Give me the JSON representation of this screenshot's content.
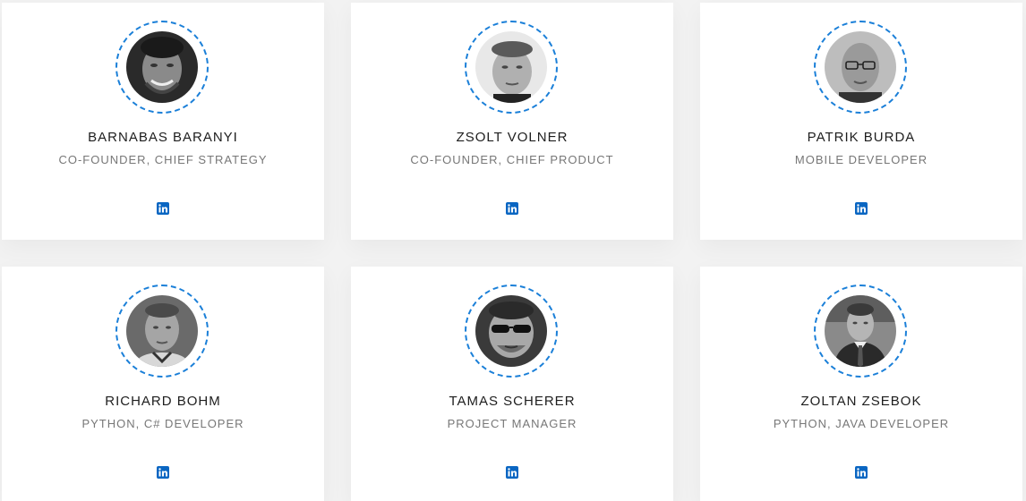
{
  "team": [
    {
      "name": "BARNABAS BARANYI",
      "role": "CO-FOUNDER, CHIEF STRATEGY",
      "social_icon": "linkedin-icon"
    },
    {
      "name": "ZSOLT VOLNER",
      "role": "CO-FOUNDER, CHIEF PRODUCT",
      "social_icon": "linkedin-icon"
    },
    {
      "name": "PATRIK BURDA",
      "role": "MOBILE DEVELOPER",
      "social_icon": "linkedin-icon"
    },
    {
      "name": "RICHARD BOHM",
      "role": "PYTHON, C# DEVELOPER",
      "social_icon": "linkedin-icon"
    },
    {
      "name": "TAMAS SCHERER",
      "role": "PROJECT MANAGER",
      "social_icon": "linkedin-icon"
    },
    {
      "name": "ZOLTAN ZSEBOK",
      "role": "PYTHON, JAVA DEVELOPER",
      "social_icon": "linkedin-icon"
    }
  ],
  "colors": {
    "accent": "#1a7fd8",
    "linkedin": "#0a66c2",
    "name_text": "#1e1e1e",
    "role_text": "#777777",
    "background": "#f2f2f2",
    "card": "#ffffff"
  }
}
